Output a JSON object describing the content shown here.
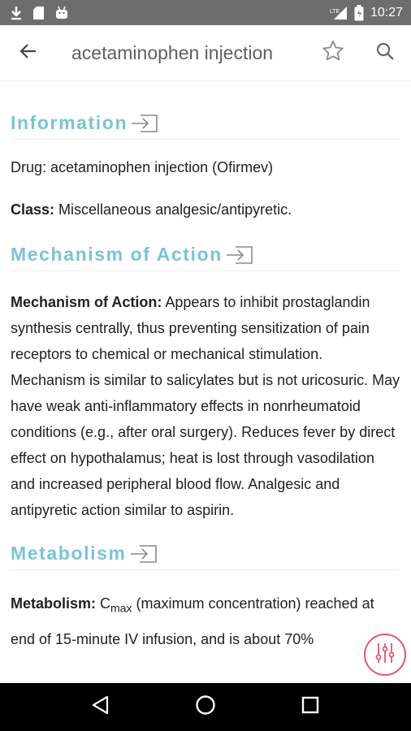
{
  "status_bar": {
    "time": "10:27",
    "icons": [
      "download-icon",
      "sd-card-icon",
      "android-icon",
      "lte-signal-icon",
      "battery-icon"
    ],
    "lte_label": "LTE"
  },
  "app_bar": {
    "title": "acetaminophen injection",
    "icons": [
      "back-arrow-icon",
      "star-outline-icon",
      "search-icon"
    ]
  },
  "colors": {
    "section_title": "#7cc3d6",
    "status_bar": "#6d6d6d",
    "fab_accent": "#e5556c"
  },
  "sections": {
    "information": {
      "title": "Information",
      "drug_label": "Drug: acetaminophen injection (Ofirmev)",
      "class_label": "Class:",
      "class_value": " Miscellaneous analgesic/antipyretic."
    },
    "mechanism": {
      "title": "Mechanism of Action",
      "label": "Mechanism of Action:",
      "text": " Appears to inhibit prostaglandin synthesis centrally, thus preventing sensitization of pain receptors to chemical or mechanical stimulation. Mechanism is similar to salicylates but is not uricosuric. May have weak anti-inflammatory effects in nonrheumatoid conditions (e.g., after oral surgery). Reduces fever by direct effect on hypothalamus; heat is lost through vasodilation and increased peripheral blood flow. Analgesic and antipyretic action similar to aspirin."
    },
    "metabolism": {
      "title": "Metabolism",
      "label": "Metabolism:",
      "c_letter": " C",
      "c_sub": "max",
      "text": " (maximum concentration) reached at end of 15-minute IV infusion, and is about 70%"
    }
  },
  "fab": {
    "icon": "equalizer-sliders-icon"
  },
  "nav_bar": {
    "icons": [
      "nav-back-icon",
      "nav-home-icon",
      "nav-recents-icon"
    ]
  }
}
